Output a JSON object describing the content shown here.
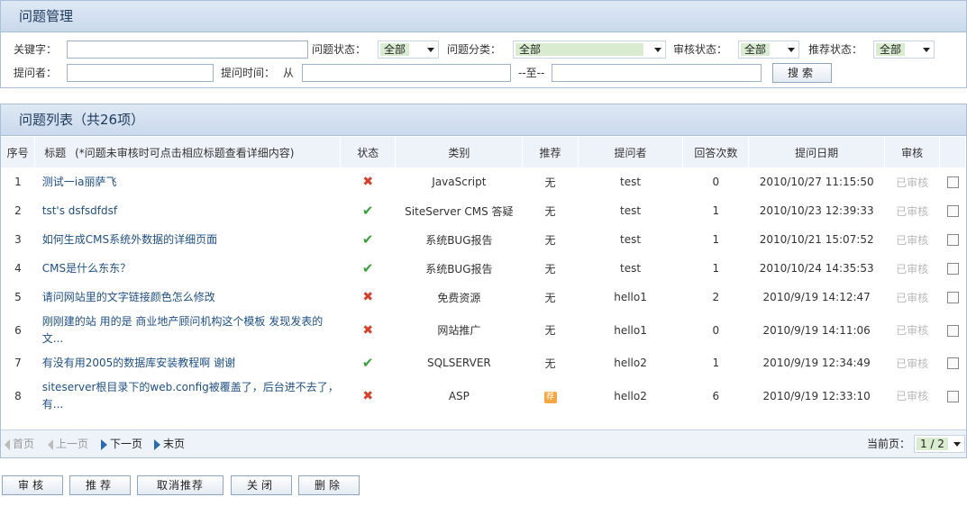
{
  "search": {
    "title": "问题管理",
    "keyword_label": "关键字：",
    "keyword_value": "",
    "status_label": "问题状态：",
    "status_value": "全部",
    "category_label": "问题分类：",
    "category_value": "全部",
    "audit_label": "审核状态：",
    "audit_value": "全部",
    "recommend_label": "推荐状态：",
    "recommend_value": "全部",
    "asker_label": "提问者：",
    "time_label": "提问时间：",
    "from_label": "从",
    "to_label": "--至--",
    "search_button": "搜索"
  },
  "list": {
    "title": "问题列表（共26项）",
    "headers": {
      "seq": "序号",
      "title": "标题",
      "title_hint": "(*问题未审核时可点击相应标题查看详细内容)",
      "status": "状态",
      "category": "类别",
      "recommend": "推荐",
      "asker": "提问者",
      "answers": "回答次数",
      "date": "提问日期",
      "audit": "审核"
    },
    "rows": [
      {
        "seq": "1",
        "title": "测试一ia丽萨飞",
        "status": "x",
        "category": "JavaScript",
        "recommend": "无",
        "asker": "test",
        "answers": "0",
        "date": "2010/10/27 11:15:50",
        "audit": "已审核"
      },
      {
        "seq": "2",
        "title": "tst's dsfsdfdsf",
        "status": "v",
        "category": "SiteServer CMS 答疑",
        "recommend": "无",
        "asker": "test",
        "answers": "1",
        "date": "2010/10/23 12:39:33",
        "audit": "已审核"
      },
      {
        "seq": "3",
        "title": "如何生成CMS系统外数据的详细页面",
        "status": "v",
        "category": "系统BUG报告",
        "recommend": "无",
        "asker": "test",
        "answers": "1",
        "date": "2010/10/21 15:07:52",
        "audit": "已审核"
      },
      {
        "seq": "4",
        "title": "CMS是什么东东？",
        "status": "v",
        "category": "系统BUG报告",
        "recommend": "无",
        "asker": "test",
        "answers": "1",
        "date": "2010/10/24 14:35:53",
        "audit": "已审核"
      },
      {
        "seq": "5",
        "title": "请问网站里的文字链接颜色怎么修改",
        "status": "x",
        "category": "免费资源",
        "recommend": "无",
        "asker": "hello1",
        "answers": "2",
        "date": "2010/9/19 14:12:47",
        "audit": "已审核"
      },
      {
        "seq": "6",
        "title": "刚刚建的站 用的是 商业地产顾问机构这个模板 发现发表的文...",
        "status": "x",
        "category": "网站推广",
        "recommend": "无",
        "asker": "hello1",
        "answers": "0",
        "date": "2010/9/19 14:11:06",
        "audit": "已审核"
      },
      {
        "seq": "7",
        "title": "有没有用2005的数据库安装教程啊 谢谢",
        "status": "v",
        "category": "SQLSERVER",
        "recommend": "无",
        "asker": "hello2",
        "answers": "1",
        "date": "2010/9/19 12:34:49",
        "audit": "已审核"
      },
      {
        "seq": "8",
        "title": "siteserver根目录下的web.config被覆盖了，后台进不去了，有...",
        "status": "x",
        "category": "ASP",
        "recommend": "荐",
        "asker": "hello2",
        "answers": "6",
        "date": "2010/9/19 12:33:10",
        "audit": "已审核"
      }
    ]
  },
  "pager": {
    "first": "首页",
    "prev": "上一页",
    "next": "下一页",
    "last": "末页",
    "current_label": "当前页：",
    "current_value": "1 / 2"
  },
  "actions": {
    "audit": "审核",
    "recommend": "推荐",
    "unrecommend": "取消推荐",
    "close": "关闭",
    "delete": "删除"
  },
  "icons": {
    "status_x": "cross-icon",
    "status_v": "check-icon",
    "recommend_badge": "recommend-badge-icon"
  },
  "colors": {
    "panel_border": "#a9c0d8",
    "header_bg": "#c9d9ec",
    "link": "#1e4f86",
    "ok_green": "#3a9e3a",
    "fail_red": "#d9402a"
  }
}
